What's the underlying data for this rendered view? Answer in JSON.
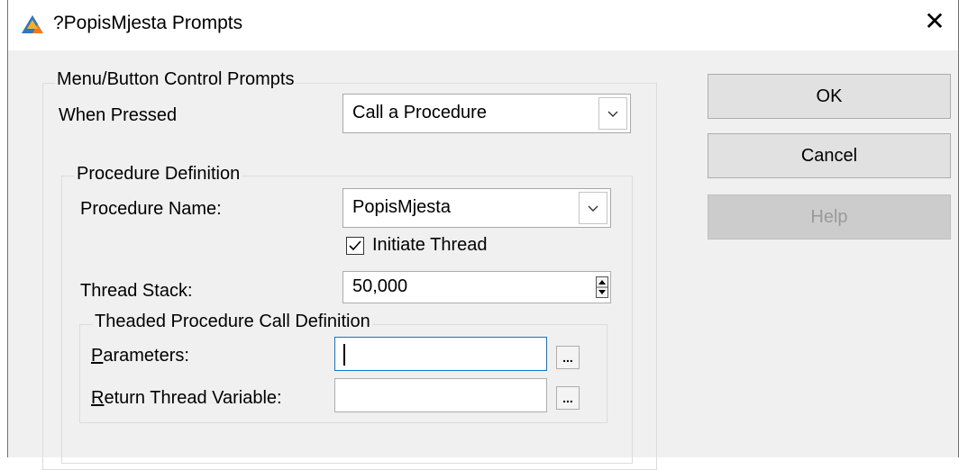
{
  "window": {
    "title": "?PopisMjesta Prompts",
    "close_glyph": "✕"
  },
  "menu_group": {
    "title": "Menu/Button Control Prompts",
    "when_pressed_label": "When Pressed",
    "when_pressed_value": "Call a Procedure"
  },
  "procedure_group": {
    "title": "Procedure Definition",
    "name_label": "Procedure Name:",
    "name_value": "PopisMjesta",
    "initiate_thread_label": "Initiate Thread",
    "initiate_thread_checked": true,
    "stack_label": "Thread Stack:",
    "stack_value": "50,000"
  },
  "threaded_group": {
    "title": "Theaded Procedure Call Definition",
    "parameters_label_accel": "P",
    "parameters_label_rest": "arameters:",
    "parameters_value": "",
    "return_label_accel": "R",
    "return_label_rest": "eturn Thread Variable:",
    "return_value": "",
    "ellipsis": "..."
  },
  "buttons": {
    "ok": "OK",
    "cancel": "Cancel",
    "help": "Help"
  }
}
